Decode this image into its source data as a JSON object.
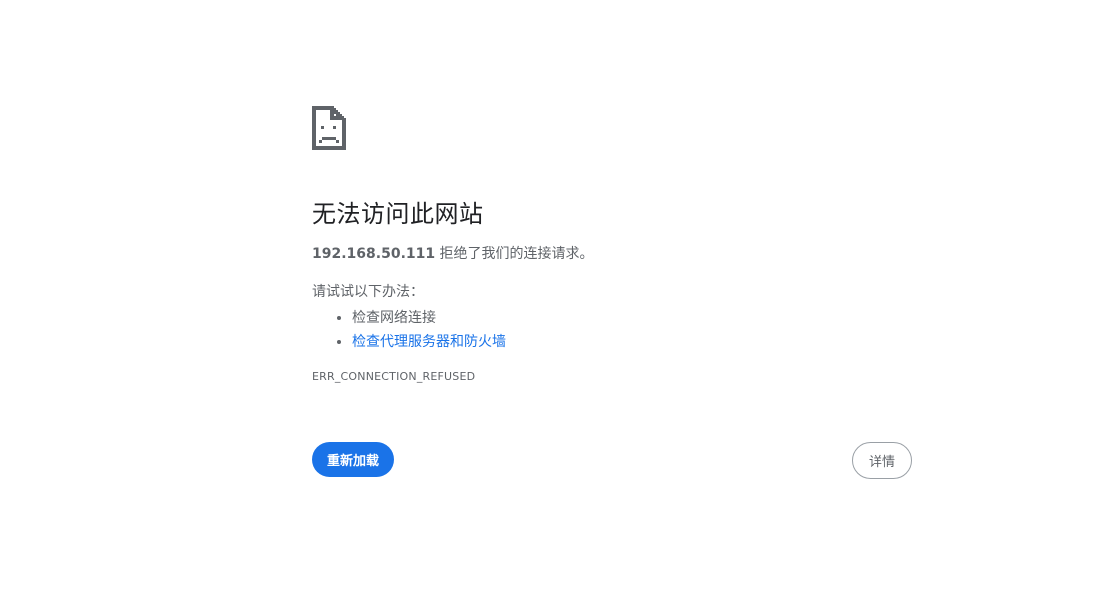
{
  "error": {
    "icon": "sad-document-icon",
    "title": "无法访问此网站",
    "host": "192.168.50.111",
    "message_suffix": " 拒绝了我们的连接请求。",
    "suggestions_heading": "请试试以下办法：",
    "suggestions": [
      {
        "label": "检查网络连接",
        "is_link": false
      },
      {
        "label": "检查代理服务器和防火墙",
        "is_link": true
      }
    ],
    "code": "ERR_CONNECTION_REFUSED"
  },
  "buttons": {
    "reload_label": "重新加载",
    "details_label": "详情"
  },
  "colors": {
    "accent": "#1a73e8",
    "title": "#202124",
    "text": "#5f6368"
  }
}
